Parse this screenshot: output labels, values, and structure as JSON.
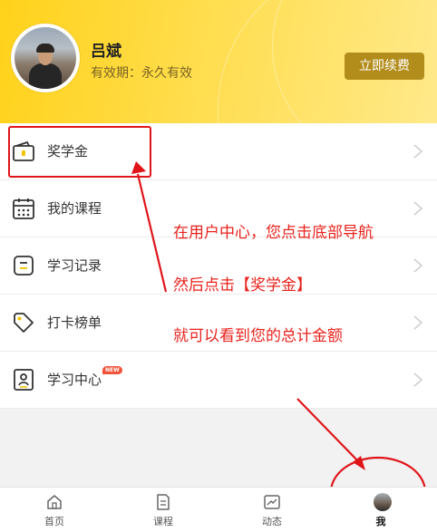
{
  "user": {
    "name": "吕斌",
    "validity": "有效期：永久有效",
    "renew_label": "立即续费"
  },
  "menu": [
    {
      "label": "奖学金",
      "icon": "wallet-icon"
    },
    {
      "label": "我的课程",
      "icon": "calendar-icon"
    },
    {
      "label": "学习记录",
      "icon": "record-icon"
    },
    {
      "label": "打卡榜单",
      "icon": "tag-icon"
    },
    {
      "label": "学习中心",
      "icon": "id-card-icon",
      "badge": "NEW"
    }
  ],
  "annotations": {
    "line1": "在用户中心，您点击底部导航",
    "line2": "然后点击【奖学金】",
    "line3": "就可以看到您的总计金额",
    "color": "#e8221c"
  },
  "tabs": [
    {
      "label": "首页",
      "icon": "home-icon"
    },
    {
      "label": "课程",
      "icon": "document-icon"
    },
    {
      "label": "动态",
      "icon": "trend-icon"
    },
    {
      "label": "我",
      "icon": "user-avatar-icon",
      "active": true
    }
  ],
  "colors": {
    "header_yellow": "#ffd21a",
    "renew_button": "#b38d1c"
  }
}
